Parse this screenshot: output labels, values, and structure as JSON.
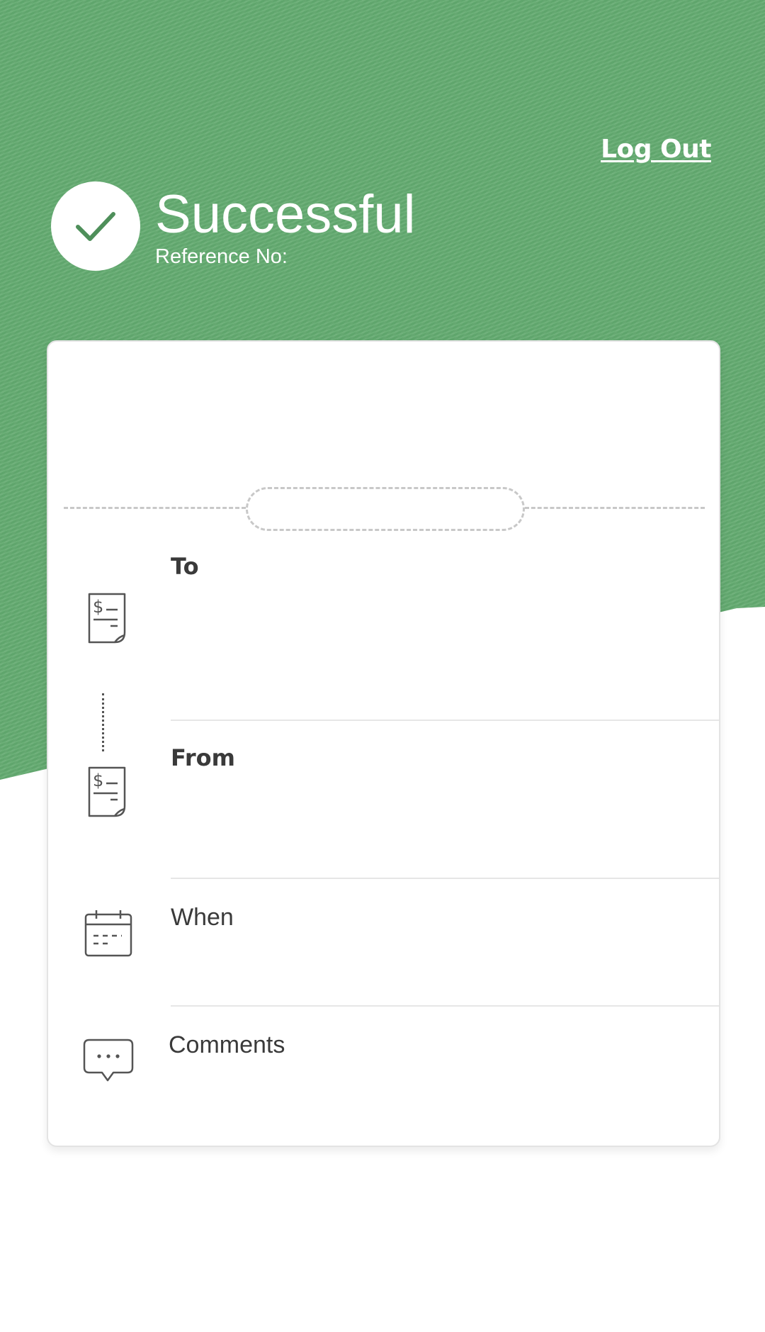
{
  "header": {
    "logout_label": "Log Out",
    "status_title": "Successful",
    "reference_label": "Reference No:"
  },
  "details": {
    "to_label": "To",
    "from_label": "From",
    "when_label": "When",
    "comments_label": "Comments"
  },
  "icons": {
    "status": "checkmark-icon",
    "to": "bill-icon",
    "from": "bill-icon",
    "when": "calendar-icon",
    "comments": "chat-bubble-icon"
  },
  "colors": {
    "accent_green": "#62aa6f",
    "checkmark": "#4e8f5a",
    "icon_stroke": "#555555"
  }
}
